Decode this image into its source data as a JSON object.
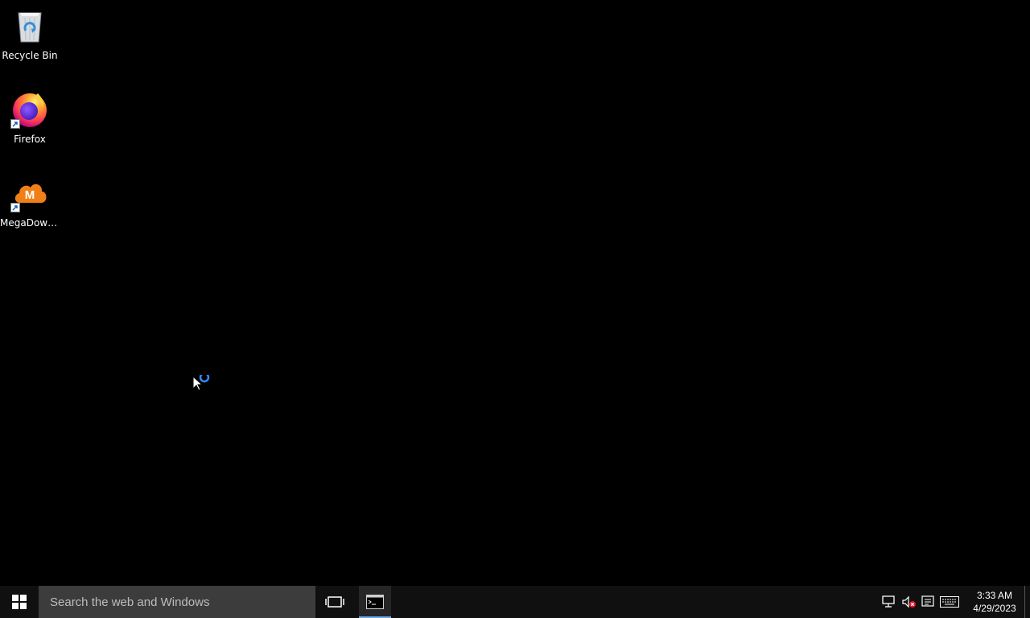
{
  "desktop": {
    "icons": [
      {
        "label": "Recycle Bin",
        "icon": "recycle-bin-icon"
      },
      {
        "label": "Firefox",
        "icon": "firefox-icon"
      },
      {
        "label": "MegaDown...",
        "icon": "megadownloader-icon"
      }
    ],
    "cursor_state": "busy"
  },
  "taskbar": {
    "search_placeholder": "Search the web and Windows",
    "pinned": [
      {
        "icon": "task-view-icon"
      },
      {
        "icon": "command-prompt-icon",
        "active": true
      }
    ],
    "tray": {
      "icons": [
        "network-icon",
        "volume-muted-icon",
        "action-center-icon",
        "keyboard-icon"
      ],
      "time": "3:33 AM",
      "date": "4/29/2023"
    }
  },
  "colors": {
    "background": "#000000",
    "taskbar": "#101010",
    "search": "#3c3c3c",
    "accent": "#6ca9e8"
  }
}
